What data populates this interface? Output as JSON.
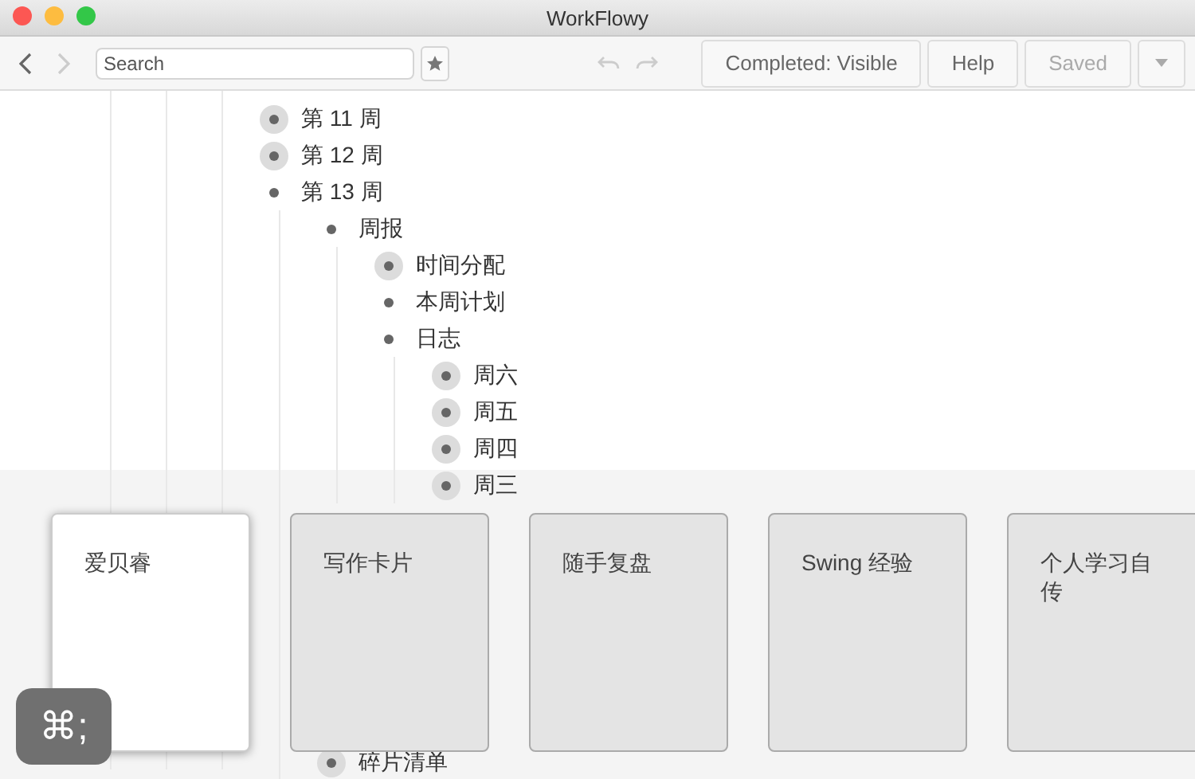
{
  "window": {
    "title": "WorkFlowy"
  },
  "toolbar": {
    "search": {
      "placeholder": "Search"
    },
    "buttons": [
      {
        "label": "Completed: Visible",
        "disabled": false
      },
      {
        "label": "Help",
        "disabled": false
      },
      {
        "label": "Saved",
        "disabled": true
      }
    ]
  },
  "outline": [
    {
      "text": "第 11 周",
      "collapsed": true
    },
    {
      "text": "第 12 周",
      "collapsed": true
    },
    {
      "text": "第 13 周",
      "collapsed": false,
      "children": [
        {
          "text": "周报",
          "collapsed": false,
          "children": [
            {
              "text": "时间分配",
              "collapsed": true
            },
            {
              "text": "本周计划",
              "collapsed": false
            },
            {
              "text": "日志",
              "collapsed": false,
              "children": [
                {
                  "text": "周六",
                  "collapsed": true
                },
                {
                  "text": "周五",
                  "collapsed": true
                },
                {
                  "text": "周四",
                  "collapsed": true
                },
                {
                  "text": "周三",
                  "collapsed": true
                }
              ]
            }
          ]
        },
        {
          "text": "碎片清单",
          "collapsed": true
        }
      ]
    }
  ],
  "switcher": {
    "shortcut": "⌘;",
    "cards": [
      {
        "label": "爱贝睿",
        "selected": true
      },
      {
        "label": "写作卡片",
        "selected": false
      },
      {
        "label": "随手复盘",
        "selected": false
      },
      {
        "label": "Swing 经验",
        "selected": false
      },
      {
        "label": "个人学习自传",
        "selected": false
      }
    ]
  }
}
